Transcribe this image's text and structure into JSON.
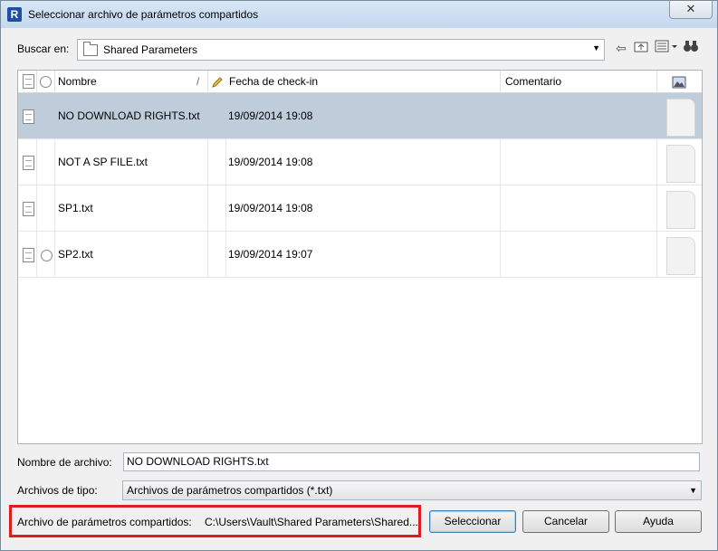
{
  "window": {
    "title": "Seleccionar archivo de parámetros compartidos",
    "app_icon_glyph": "R",
    "close_glyph": "✕"
  },
  "lookin": {
    "label": "Buscar en:",
    "value": "Shared Parameters"
  },
  "toolbar": {
    "icons": [
      "back-arrow-icon",
      "up-folder-icon",
      "view-menu-icon",
      "binoculars-icon"
    ]
  },
  "columns": {
    "name": "Nombre",
    "checkin": "Fecha de check-in",
    "comment": "Comentario",
    "sort_glyph": "/"
  },
  "files": [
    {
      "name": "NO DOWNLOAD RIGHTS.txt",
      "date": "19/09/2014 19:08",
      "comment": "",
      "status": false,
      "selected": true
    },
    {
      "name": "NOT A SP FILE.txt",
      "date": "19/09/2014 19:08",
      "comment": "",
      "status": false,
      "selected": false
    },
    {
      "name": "SP1.txt",
      "date": "19/09/2014 19:08",
      "comment": "",
      "status": false,
      "selected": false
    },
    {
      "name": "SP2.txt",
      "date": "19/09/2014 19:07",
      "comment": "",
      "status": true,
      "selected": false
    }
  ],
  "filename": {
    "label": "Nombre de archivo:",
    "value": "NO DOWNLOAD RIGHTS.txt"
  },
  "filetype": {
    "label": "Archivos de tipo:",
    "value": "Archivos de parámetros compartidos (*.txt)"
  },
  "shared_file": {
    "label": "Archivo de parámetros compartidos:",
    "value": "C:\\Users\\Vault\\Shared  Parameters\\Shared..."
  },
  "buttons": {
    "select": "Seleccionar",
    "cancel": "Cancelar",
    "help": "Ayuda"
  },
  "colors": {
    "selection": "#bfcddb",
    "highlight_box": "#e01b24"
  }
}
